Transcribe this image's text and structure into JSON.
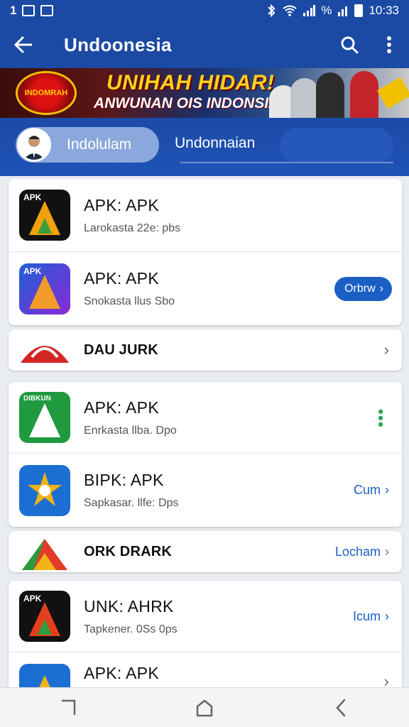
{
  "status_bar": {
    "left_text": "1",
    "signal_text": "%",
    "time": "10:33"
  },
  "app_bar": {
    "title": "Undoonesia",
    "back_icon": "arrow-left-icon",
    "search_icon": "search-icon",
    "more_icon": "more-vertical-icon"
  },
  "banner": {
    "headline": "UNIHAH HIDAR!",
    "subline": "ANWUNAN OIS INDONSIA",
    "seal_text": "INDOMRAH"
  },
  "profile_strip": {
    "pill_label": "Indolulam",
    "tab_label": "Undonnaian"
  },
  "list": {
    "items": [
      {
        "title": "APK: APK",
        "subtitle": "Larokasta 22e: pbs",
        "icon_label": "APK",
        "action": ""
      },
      {
        "title": "APK: APK",
        "subtitle": "Snokasta llus Sbo",
        "icon_label": "APK",
        "action": "Orbrw"
      },
      {
        "title": "DAU JURK",
        "action": ""
      },
      {
        "title": "APK: APK",
        "subtitle": "Enrkasta llba. Dpo",
        "icon_label": "DIBKUN",
        "action": ""
      },
      {
        "title": "BIPK: APK",
        "subtitle": "Sapkasar. llfe: Dps",
        "icon_label": "",
        "action": "Cum"
      },
      {
        "title": "ORK DRARK",
        "action": "Locham"
      },
      {
        "title": "UNK: AHRK",
        "subtitle": "Tapkener. 0Ss 0ps",
        "icon_label": "APK",
        "action": "Icum"
      },
      {
        "title": "APK: APK",
        "subtitle": "",
        "icon_label": "",
        "action": ""
      }
    ]
  },
  "nav_bar": {
    "recent_icon": "recent-apps-icon",
    "home_icon": "home-icon",
    "back_icon": "back-icon"
  }
}
